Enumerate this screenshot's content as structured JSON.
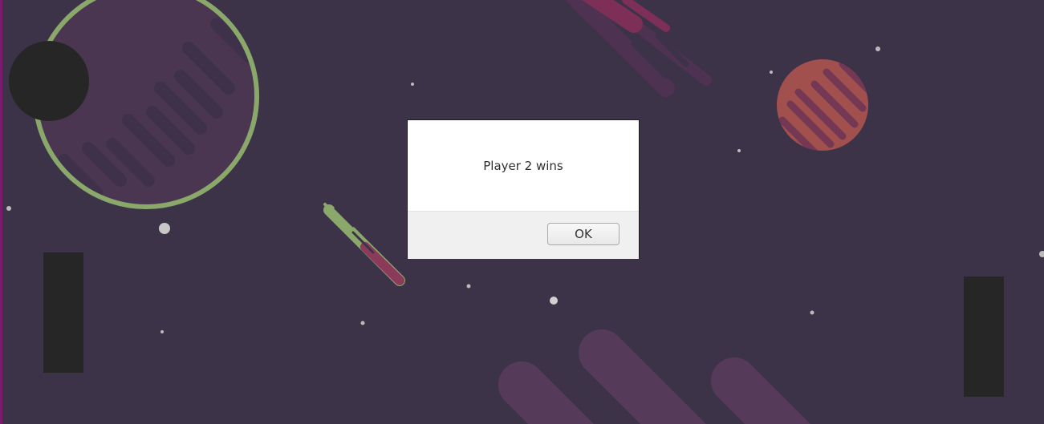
{
  "dialog": {
    "message": "Player 2 wins",
    "ok_label": "OK"
  },
  "colors": {
    "background": "#3d3349",
    "paddle": "#262626",
    "ring": "#8aa86a",
    "planet": "#b0554f",
    "accent_edge": "#7a1a6e"
  }
}
